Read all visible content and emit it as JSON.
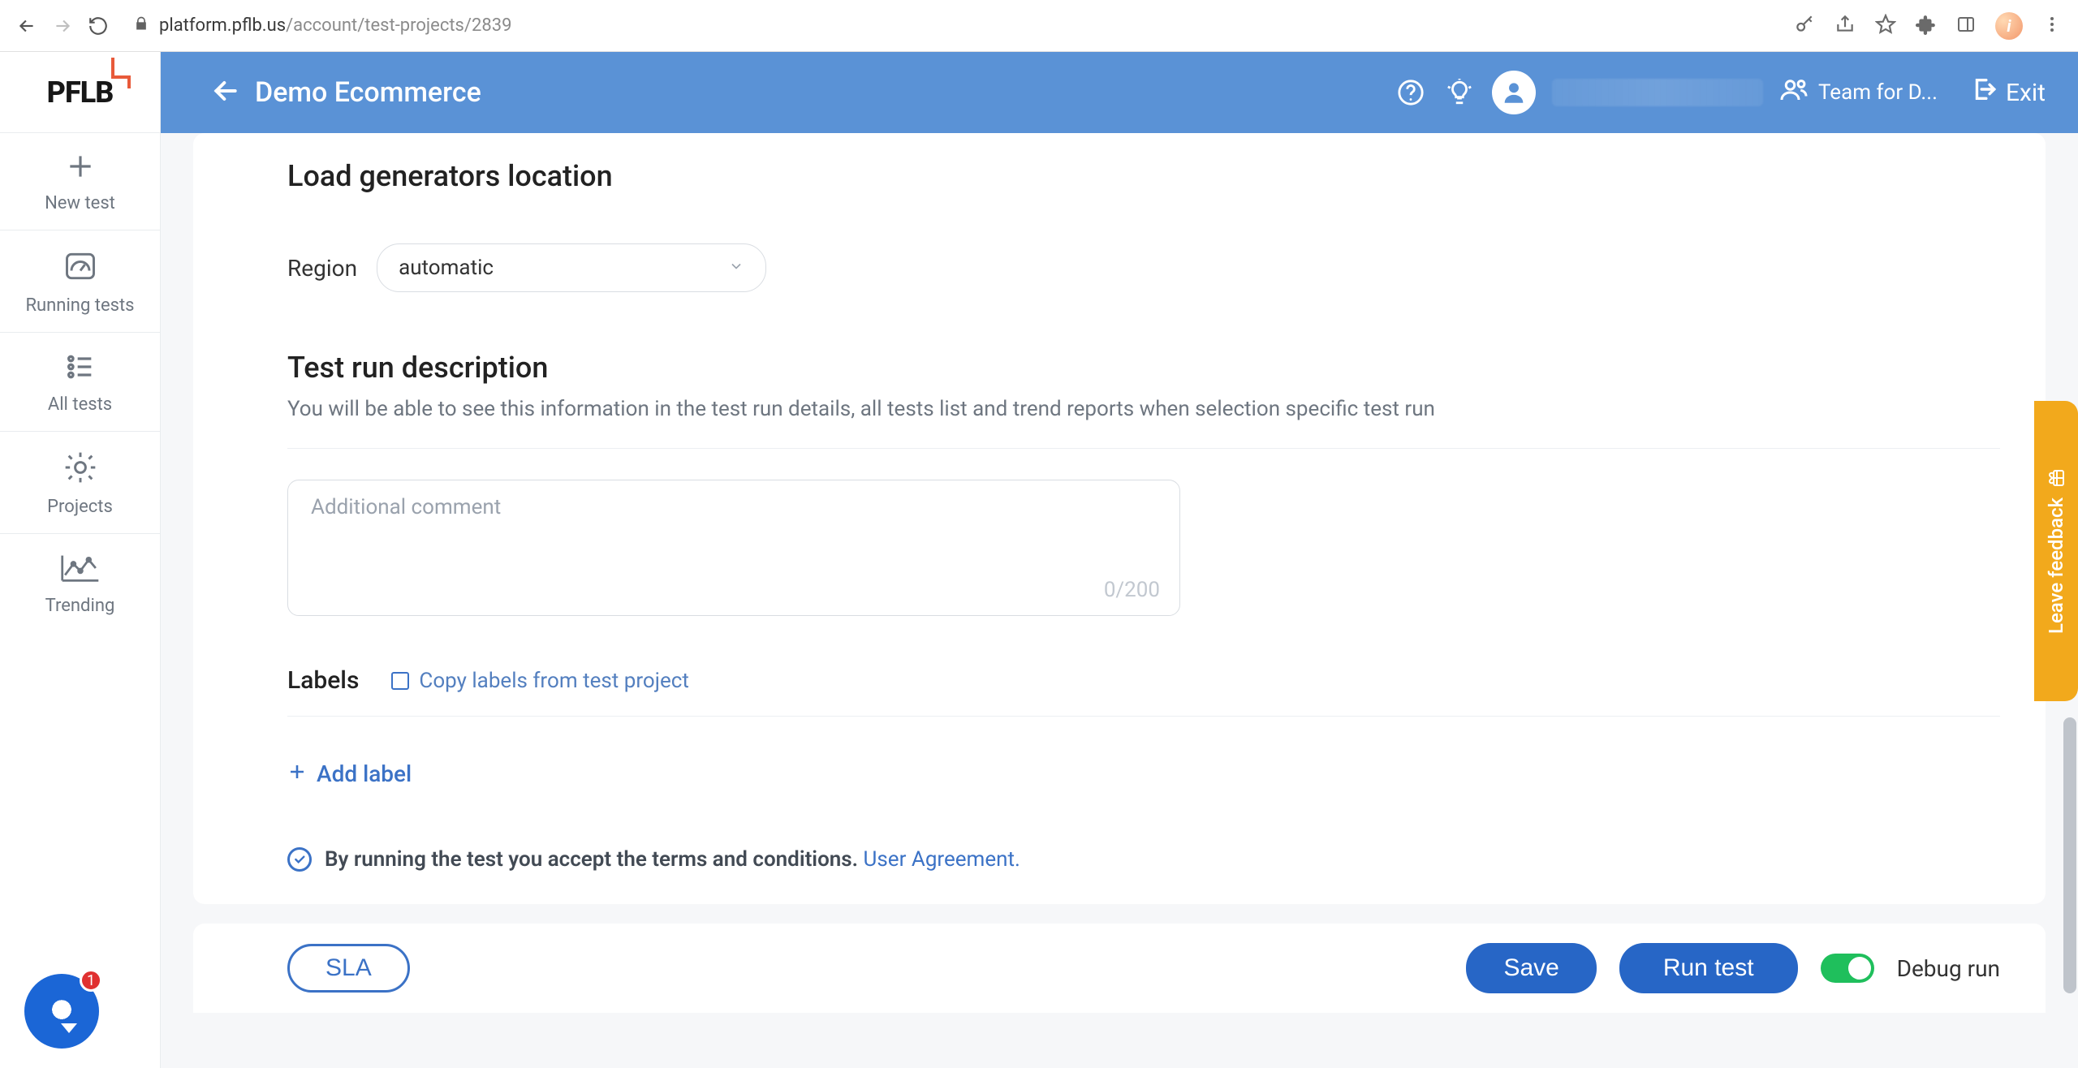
{
  "browser": {
    "url_host": "platform.pflb.us",
    "url_path": "/account/test-projects/2839"
  },
  "logo": {
    "text": "PFLB"
  },
  "sidebar": {
    "items": [
      {
        "label": "New test"
      },
      {
        "label": "Running tests"
      },
      {
        "label": "All tests"
      },
      {
        "label": "Projects"
      },
      {
        "label": "Trending"
      }
    ]
  },
  "topbar": {
    "project": "Demo Ecommerce",
    "team": "Team for D...",
    "exit": "Exit"
  },
  "section": {
    "generators_title": "Load generators location",
    "region_label": "Region",
    "region_value": "automatic",
    "run_desc_title": "Test run description",
    "run_desc_sub": "You will be able to see this information in the test run details, all tests list and trend reports when selection specific test run",
    "comment_placeholder": "Additional comment",
    "char_count": "0/200",
    "labels_title": "Labels",
    "copy_labels": "Copy labels from test project",
    "add_label": "Add label",
    "terms_text": "By running the test you accept the terms and conditions. ",
    "terms_link": "User Agreement."
  },
  "bottom": {
    "sla": "SLA",
    "save": "Save",
    "run": "Run test",
    "debug": "Debug run"
  },
  "feedback": {
    "label": "Leave feedback"
  },
  "chat_badge": "1"
}
